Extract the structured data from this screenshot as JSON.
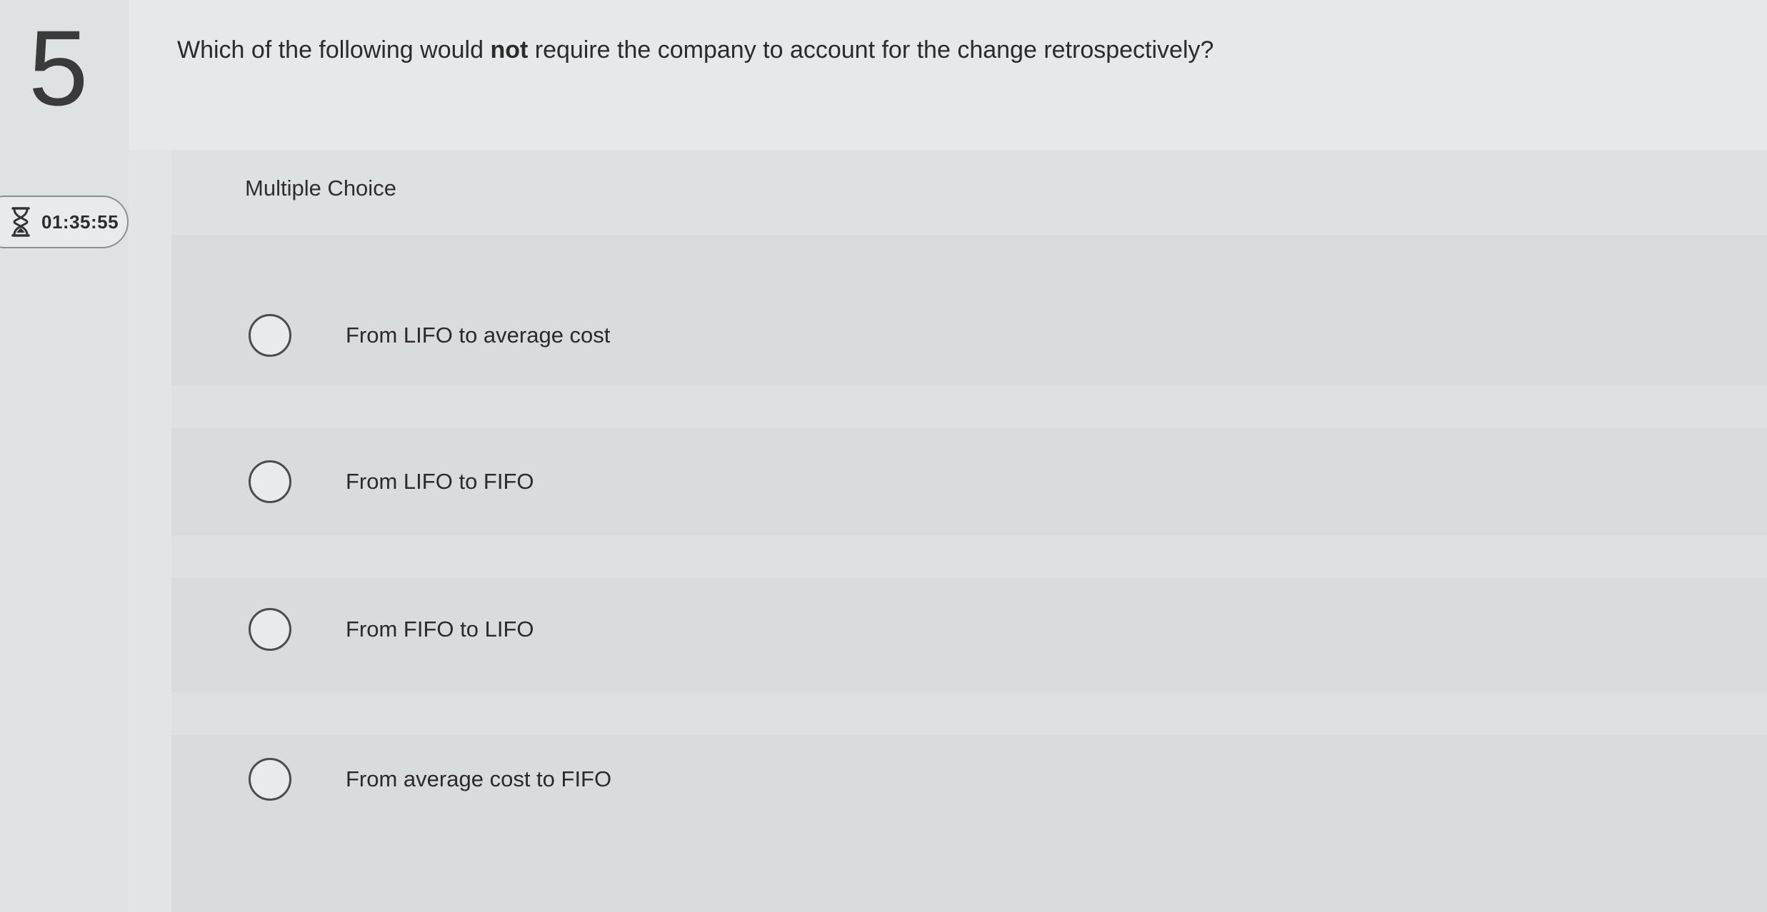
{
  "question": {
    "number": "5",
    "text_before": "Which of the following would ",
    "text_emphasis": "not",
    "text_after": " require the company to account for the change retrospectively?"
  },
  "timer": {
    "icon": "hourglass-icon",
    "value": "01:35:55"
  },
  "answer": {
    "type_label": "Multiple Choice",
    "choices": [
      {
        "label": "From LIFO to average cost",
        "selected": false
      },
      {
        "label": "From LIFO to FIFO",
        "selected": false
      },
      {
        "label": "From FIFO to LIFO",
        "selected": false
      },
      {
        "label": "From average cost to FIFO",
        "selected": false
      }
    ]
  }
}
